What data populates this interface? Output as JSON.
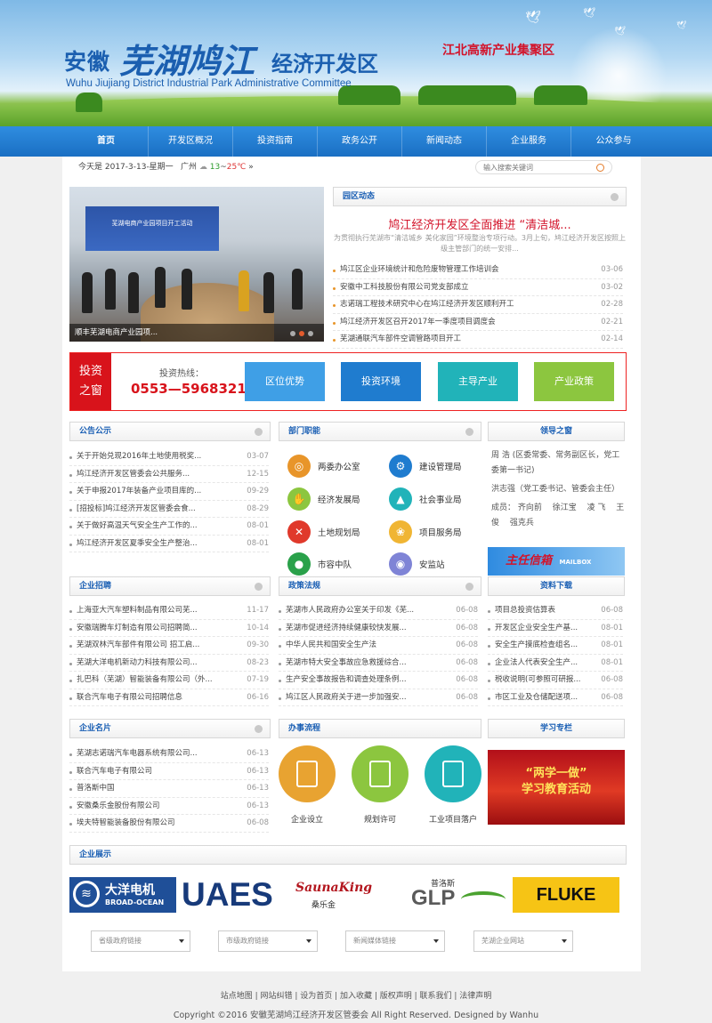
{
  "banner": {
    "logo_prefix": "安徽",
    "logo_calligraphy": "芜湖鸠江",
    "logo_suffix": "经济开发区",
    "logo_english": "Wuhu Jiujiang District Industrial Park Administrative Committee",
    "slogan": "江北高新产业集聚区"
  },
  "nav": {
    "items": [
      "首页",
      "开发区概况",
      "投资指南",
      "政务公开",
      "新闻动态",
      "企业服务",
      "公众参与"
    ]
  },
  "topbar": {
    "date": "今天是 2017-3-13-星期一",
    "city": "广州",
    "temp_low": "13",
    "temp_sep": "~",
    "temp_high": "25℃",
    "arrow": "»",
    "search_placeholder": "输入搜索关键词"
  },
  "carousel": {
    "caption": "顺丰芜湖电商产业园项...",
    "stage_text": "芜湖电商产业园项目开工活动"
  },
  "park_news": {
    "title": "园区动态",
    "headline": "鸠江经济开发区全面推进 “清洁城...",
    "summary": "为贯彻执行芜湖市“清洁城乡 美化家园”环境整治专项行动。3月上旬，鸠江经济开发区按照上级主管部门的统一安排...",
    "items": [
      {
        "title": "鸠江区企业环境统计和危险废物管理工作培训会",
        "date": "03-06"
      },
      {
        "title": "安徽中工科技股份有限公司党支部成立",
        "date": "03-02"
      },
      {
        "title": "志诺瑞工程技术研究中心在鸠江经济开发区顺利开工",
        "date": "02-28"
      },
      {
        "title": "鸠江经济开发区召开2017年一季度项目调度会",
        "date": "02-21"
      },
      {
        "title": "芜湖通联汽车部件空调管路项目开工",
        "date": "02-14"
      }
    ]
  },
  "invest": {
    "tag_line1": "投资",
    "tag_line2": "之窗",
    "hotline_label": "投资热线：",
    "hotline": "0553—5968321",
    "buttons": [
      "区位优势",
      "投资环境",
      "主导产业",
      "产业政策"
    ]
  },
  "notice": {
    "title": "公告公示",
    "items": [
      {
        "title": "关于开始兑现2016年土地使用税奖...",
        "date": "03-07"
      },
      {
        "title": "鸠江经济开发区管委会公共服务...",
        "date": "12-15"
      },
      {
        "title": "关于申报2017年装备产业项目库的...",
        "date": "09-29"
      },
      {
        "title": "[招投标]鸠江经济开发区管委会食...",
        "date": "08-29"
      },
      {
        "title": "关于做好高温天气安全生产工作的...",
        "date": "08-01"
      },
      {
        "title": "鸠江经济开发区夏季安全生产整治...",
        "date": "08-01"
      }
    ]
  },
  "dept": {
    "title": "部门职能",
    "items": [
      "两委办公室",
      "建设管理局",
      "经济发展局",
      "社会事业局",
      "土地规划局",
      "项目服务局",
      "市容中队",
      "安监站"
    ]
  },
  "leader": {
    "title": "领导之窗",
    "lines": [
      "周 浩 (区委常委、常务副区长，党工委第一书记)",
      "洪志强（党工委书记、管委会主任）",
      "成员： 齐向前　 徐江宝　 凌 飞　 王 俊　 强克兵"
    ],
    "mailbox": "主任信箱",
    "mailbox_en": "MAILBOX"
  },
  "recruit": {
    "title": "企业招聘",
    "items": [
      {
        "title": "上海亚大汽车塑料制品有限公司芜...",
        "date": "11-17"
      },
      {
        "title": "安徽瑞腾车灯制造有限公司招聘简...",
        "date": "10-14"
      },
      {
        "title": "芜湖双林汽车部件有限公司 招工启...",
        "date": "09-30"
      },
      {
        "title": "芜湖大洋电机新动力科技有限公司...",
        "date": "08-23"
      },
      {
        "title": "扎巴科（芜湖）智能装备有限公司（外...",
        "date": "07-19"
      },
      {
        "title": "联合汽车电子有限公司招聘信息",
        "date": "06-16"
      }
    ]
  },
  "policy": {
    "title": "政策法规",
    "items": [
      {
        "title": "芜湖市人民政府办公室关于印发《芜...",
        "date": "06-08"
      },
      {
        "title": "芜湖市促进经济持续健康较快发展...",
        "date": "06-08"
      },
      {
        "title": "中华人民共和国安全生产法",
        "date": "06-08"
      },
      {
        "title": "芜湖市特大安全事故应急救援综合...",
        "date": "06-08"
      },
      {
        "title": "生产安全事故报告和调查处理条例...",
        "date": "06-08"
      },
      {
        "title": "鸠江区人民政府关于进一步加强安...",
        "date": "06-08"
      }
    ]
  },
  "download": {
    "title": "资料下载",
    "items": [
      {
        "title": "项目总投资估算表",
        "date": "06-08"
      },
      {
        "title": "开发区企业安全生产基...",
        "date": "08-01"
      },
      {
        "title": "安全生产摸底检查组名...",
        "date": "08-01"
      },
      {
        "title": "企业法人代表安全生产...",
        "date": "08-01"
      },
      {
        "title": "税收说明(可参照可研报...",
        "date": "06-08"
      },
      {
        "title": "市区工业及仓储配送项...",
        "date": "06-08"
      }
    ]
  },
  "companies": {
    "title": "企业名片",
    "items": [
      {
        "title": "芜湖志诺瑞汽车电器系统有限公司...",
        "date": "06-13"
      },
      {
        "title": "联合汽车电子有限公司",
        "date": "06-13"
      },
      {
        "title": "普洛斯中国",
        "date": "06-13"
      },
      {
        "title": "安徽桑乐金股份有限公司",
        "date": "06-13"
      },
      {
        "title": "埃夫特智能装备股份有限公司",
        "date": "06-08"
      }
    ]
  },
  "process": {
    "title": "办事流程",
    "items": [
      "企业设立",
      "规划许可",
      "工业项目落户"
    ]
  },
  "study": {
    "title": "学习专栏",
    "line1": "“两学一做”",
    "line2": "学习教育活动"
  },
  "showcase": {
    "title": "企业展示",
    "logos": {
      "broad_cn": "大洋电机",
      "broad_en": "BROAD-OCEAN",
      "uaes": "UAES",
      "sauna_en": "SaunaKing",
      "sauna_cn": "桑乐金",
      "glp_cn": "普洛斯",
      "glp_en": "GLP",
      "fluke": "FLUKE"
    }
  },
  "links": {
    "selects": [
      "省级政府链接",
      "市级政府链接",
      "新闻媒体链接",
      "芜湖企业网站"
    ]
  },
  "footer": {
    "links": "站点地图 | 网站纠错 | 设为首页 | 加入收藏 | 版权声明 | 联系我们 | 法律声明",
    "copyright": "Copyright ©2016 安徽芜湖鸠江经济开发区管委会 All Right Reserved. Designed by Wanhu"
  },
  "colors": {
    "nav": "#1f78cf",
    "accent_red": "#d8131b",
    "btn_location": "#3f9fe6",
    "btn_environment": "#1f7ccf",
    "btn_industry": "#21b3b9",
    "btn_policy": "#8cc63f"
  }
}
